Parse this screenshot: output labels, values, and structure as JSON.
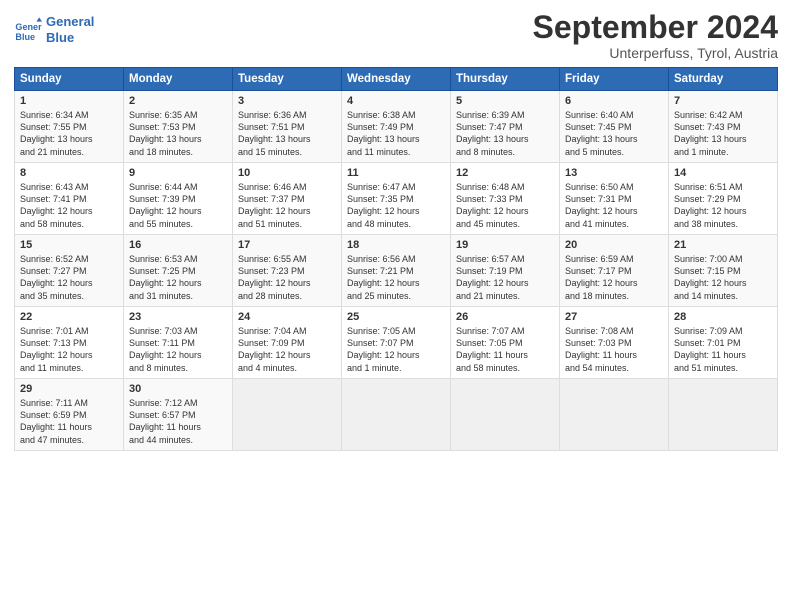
{
  "logo": {
    "line1": "General",
    "line2": "Blue"
  },
  "title": "September 2024",
  "subtitle": "Unterperfuss, Tyrol, Austria",
  "weekdays": [
    "Sunday",
    "Monday",
    "Tuesday",
    "Wednesday",
    "Thursday",
    "Friday",
    "Saturday"
  ],
  "weeks": [
    [
      {
        "day": "1",
        "info": "Sunrise: 6:34 AM\nSunset: 7:55 PM\nDaylight: 13 hours\nand 21 minutes."
      },
      {
        "day": "2",
        "info": "Sunrise: 6:35 AM\nSunset: 7:53 PM\nDaylight: 13 hours\nand 18 minutes."
      },
      {
        "day": "3",
        "info": "Sunrise: 6:36 AM\nSunset: 7:51 PM\nDaylight: 13 hours\nand 15 minutes."
      },
      {
        "day": "4",
        "info": "Sunrise: 6:38 AM\nSunset: 7:49 PM\nDaylight: 13 hours\nand 11 minutes."
      },
      {
        "day": "5",
        "info": "Sunrise: 6:39 AM\nSunset: 7:47 PM\nDaylight: 13 hours\nand 8 minutes."
      },
      {
        "day": "6",
        "info": "Sunrise: 6:40 AM\nSunset: 7:45 PM\nDaylight: 13 hours\nand 5 minutes."
      },
      {
        "day": "7",
        "info": "Sunrise: 6:42 AM\nSunset: 7:43 PM\nDaylight: 13 hours\nand 1 minute."
      }
    ],
    [
      {
        "day": "8",
        "info": "Sunrise: 6:43 AM\nSunset: 7:41 PM\nDaylight: 12 hours\nand 58 minutes."
      },
      {
        "day": "9",
        "info": "Sunrise: 6:44 AM\nSunset: 7:39 PM\nDaylight: 12 hours\nand 55 minutes."
      },
      {
        "day": "10",
        "info": "Sunrise: 6:46 AM\nSunset: 7:37 PM\nDaylight: 12 hours\nand 51 minutes."
      },
      {
        "day": "11",
        "info": "Sunrise: 6:47 AM\nSunset: 7:35 PM\nDaylight: 12 hours\nand 48 minutes."
      },
      {
        "day": "12",
        "info": "Sunrise: 6:48 AM\nSunset: 7:33 PM\nDaylight: 12 hours\nand 45 minutes."
      },
      {
        "day": "13",
        "info": "Sunrise: 6:50 AM\nSunset: 7:31 PM\nDaylight: 12 hours\nand 41 minutes."
      },
      {
        "day": "14",
        "info": "Sunrise: 6:51 AM\nSunset: 7:29 PM\nDaylight: 12 hours\nand 38 minutes."
      }
    ],
    [
      {
        "day": "15",
        "info": "Sunrise: 6:52 AM\nSunset: 7:27 PM\nDaylight: 12 hours\nand 35 minutes."
      },
      {
        "day": "16",
        "info": "Sunrise: 6:53 AM\nSunset: 7:25 PM\nDaylight: 12 hours\nand 31 minutes."
      },
      {
        "day": "17",
        "info": "Sunrise: 6:55 AM\nSunset: 7:23 PM\nDaylight: 12 hours\nand 28 minutes."
      },
      {
        "day": "18",
        "info": "Sunrise: 6:56 AM\nSunset: 7:21 PM\nDaylight: 12 hours\nand 25 minutes."
      },
      {
        "day": "19",
        "info": "Sunrise: 6:57 AM\nSunset: 7:19 PM\nDaylight: 12 hours\nand 21 minutes."
      },
      {
        "day": "20",
        "info": "Sunrise: 6:59 AM\nSunset: 7:17 PM\nDaylight: 12 hours\nand 18 minutes."
      },
      {
        "day": "21",
        "info": "Sunrise: 7:00 AM\nSunset: 7:15 PM\nDaylight: 12 hours\nand 14 minutes."
      }
    ],
    [
      {
        "day": "22",
        "info": "Sunrise: 7:01 AM\nSunset: 7:13 PM\nDaylight: 12 hours\nand 11 minutes."
      },
      {
        "day": "23",
        "info": "Sunrise: 7:03 AM\nSunset: 7:11 PM\nDaylight: 12 hours\nand 8 minutes."
      },
      {
        "day": "24",
        "info": "Sunrise: 7:04 AM\nSunset: 7:09 PM\nDaylight: 12 hours\nand 4 minutes."
      },
      {
        "day": "25",
        "info": "Sunrise: 7:05 AM\nSunset: 7:07 PM\nDaylight: 12 hours\nand 1 minute."
      },
      {
        "day": "26",
        "info": "Sunrise: 7:07 AM\nSunset: 7:05 PM\nDaylight: 11 hours\nand 58 minutes."
      },
      {
        "day": "27",
        "info": "Sunrise: 7:08 AM\nSunset: 7:03 PM\nDaylight: 11 hours\nand 54 minutes."
      },
      {
        "day": "28",
        "info": "Sunrise: 7:09 AM\nSunset: 7:01 PM\nDaylight: 11 hours\nand 51 minutes."
      }
    ],
    [
      {
        "day": "29",
        "info": "Sunrise: 7:11 AM\nSunset: 6:59 PM\nDaylight: 11 hours\nand 47 minutes."
      },
      {
        "day": "30",
        "info": "Sunrise: 7:12 AM\nSunset: 6:57 PM\nDaylight: 11 hours\nand 44 minutes."
      },
      {
        "day": "",
        "info": ""
      },
      {
        "day": "",
        "info": ""
      },
      {
        "day": "",
        "info": ""
      },
      {
        "day": "",
        "info": ""
      },
      {
        "day": "",
        "info": ""
      }
    ]
  ]
}
